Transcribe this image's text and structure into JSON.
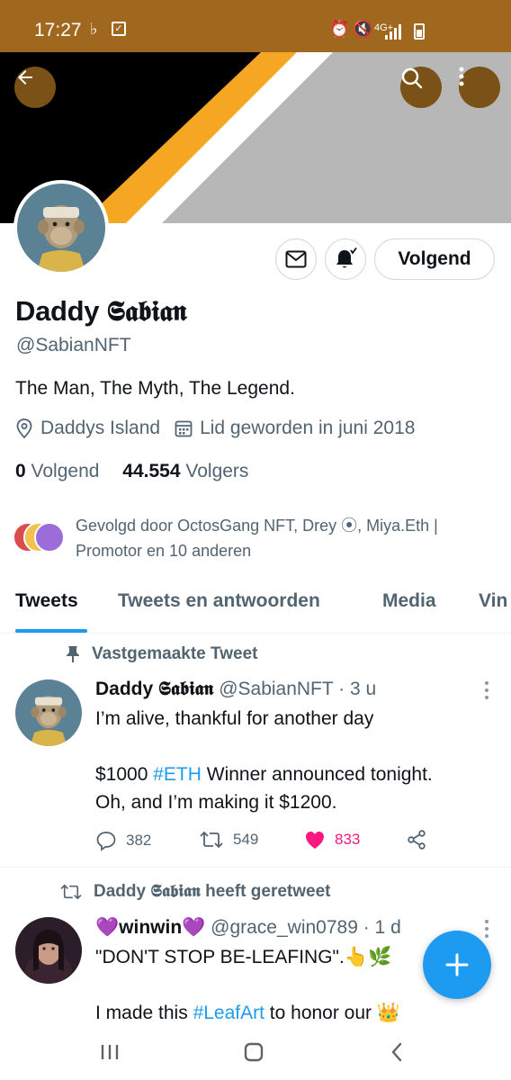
{
  "status_bar": {
    "time": "17:27",
    "network": "4G+"
  },
  "profile": {
    "name": "Daddy 𝕾𝖆𝖇𝖎𝖆𝖓",
    "handle": "@SabianNFT",
    "bio": "The Man, The Myth, The Legend.",
    "location": "Daddys Island",
    "joined": "Lid geworden in juni 2018",
    "following_count": "0",
    "following_label": "Volgend",
    "followers_count": "44.554",
    "followers_label": "Volgers",
    "follow_button": "Volgend",
    "followed_by": "Gevolgd door OctosGang NFT, Drey ⦿, Miya.Eth | Promotor en 10 anderen"
  },
  "tabs": [
    {
      "label": "Tweets",
      "active": true
    },
    {
      "label": "Tweets en antwoorden",
      "active": false
    },
    {
      "label": "Media",
      "active": false
    },
    {
      "label": "Vin",
      "active": false
    }
  ],
  "tweets": [
    {
      "context": "Vastgemaakte Tweet",
      "author_name": "Daddy 𝕾𝖆𝖇𝖎𝖆𝖓",
      "author_handle": "@SabianNFT · 3 u",
      "line1": "I’m alive, thankful for another day",
      "line2_pre": "$1000 ",
      "line2_link": "#ETH",
      "line2_post": " Winner announced tonight.",
      "line3": "Oh, and I’m making it $1200.",
      "replies": "382",
      "retweets": "549",
      "likes": "833"
    },
    {
      "context": "Daddy 𝕾𝖆𝖇𝖎𝖆𝖓 heeft geretweet",
      "author_name": "💜winwin💜",
      "author_handle": "@grace_win0789 · 1 d",
      "line1": "\"DON'T STOP BE-LEAFING\".👆🌿",
      "line3_pre": "I made this ",
      "line3_link": "#LeafArt",
      "line3_post": " to honor our 👑"
    }
  ],
  "colors": {
    "status_bar": "#a0681f",
    "accent": "#1d9bf0",
    "like": "#f91880",
    "secondary_text": "#536471"
  },
  "icons": [
    "back-arrow-icon",
    "search-icon",
    "more-vertical-icon",
    "mail-icon",
    "bell-icon",
    "location-icon",
    "calendar-icon",
    "pin-icon",
    "retweet-icon",
    "reply-icon",
    "heart-icon",
    "share-icon",
    "plus-icon"
  ]
}
